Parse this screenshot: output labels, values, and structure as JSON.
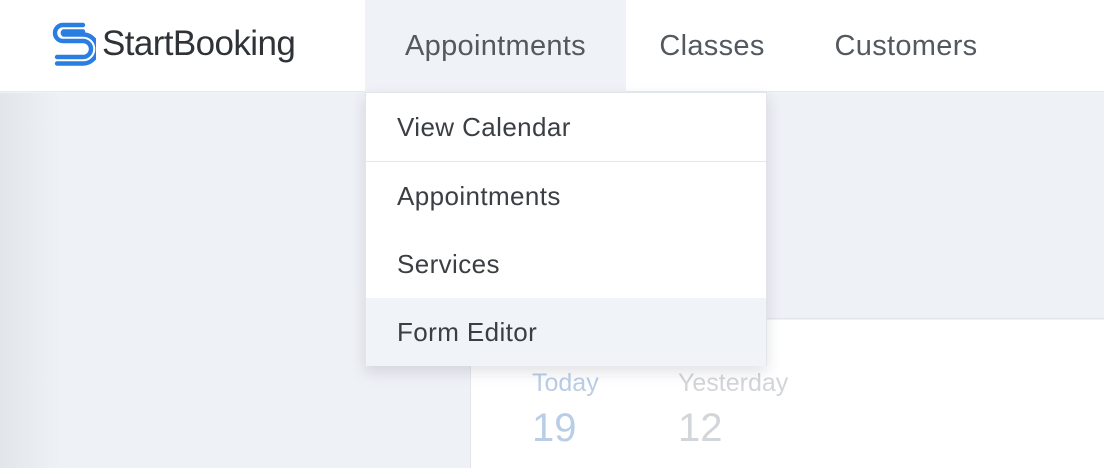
{
  "brand": {
    "name": "StartBooking",
    "logo_icon": "s-link-logo-icon",
    "logo_color": "#2a7de1"
  },
  "nav": {
    "items": [
      {
        "label": "Appointments",
        "active": true
      },
      {
        "label": "Classes"
      },
      {
        "label": "Customers"
      }
    ]
  },
  "dropdown": {
    "items": [
      {
        "label": "View Calendar"
      },
      {
        "label": "Appointments"
      },
      {
        "label": "Services"
      },
      {
        "label": "Form Editor",
        "hovered": true
      }
    ]
  },
  "stats": {
    "today": {
      "label": "Today",
      "value": "19"
    },
    "yesterday": {
      "label": "Yesterday",
      "value": "12"
    }
  }
}
